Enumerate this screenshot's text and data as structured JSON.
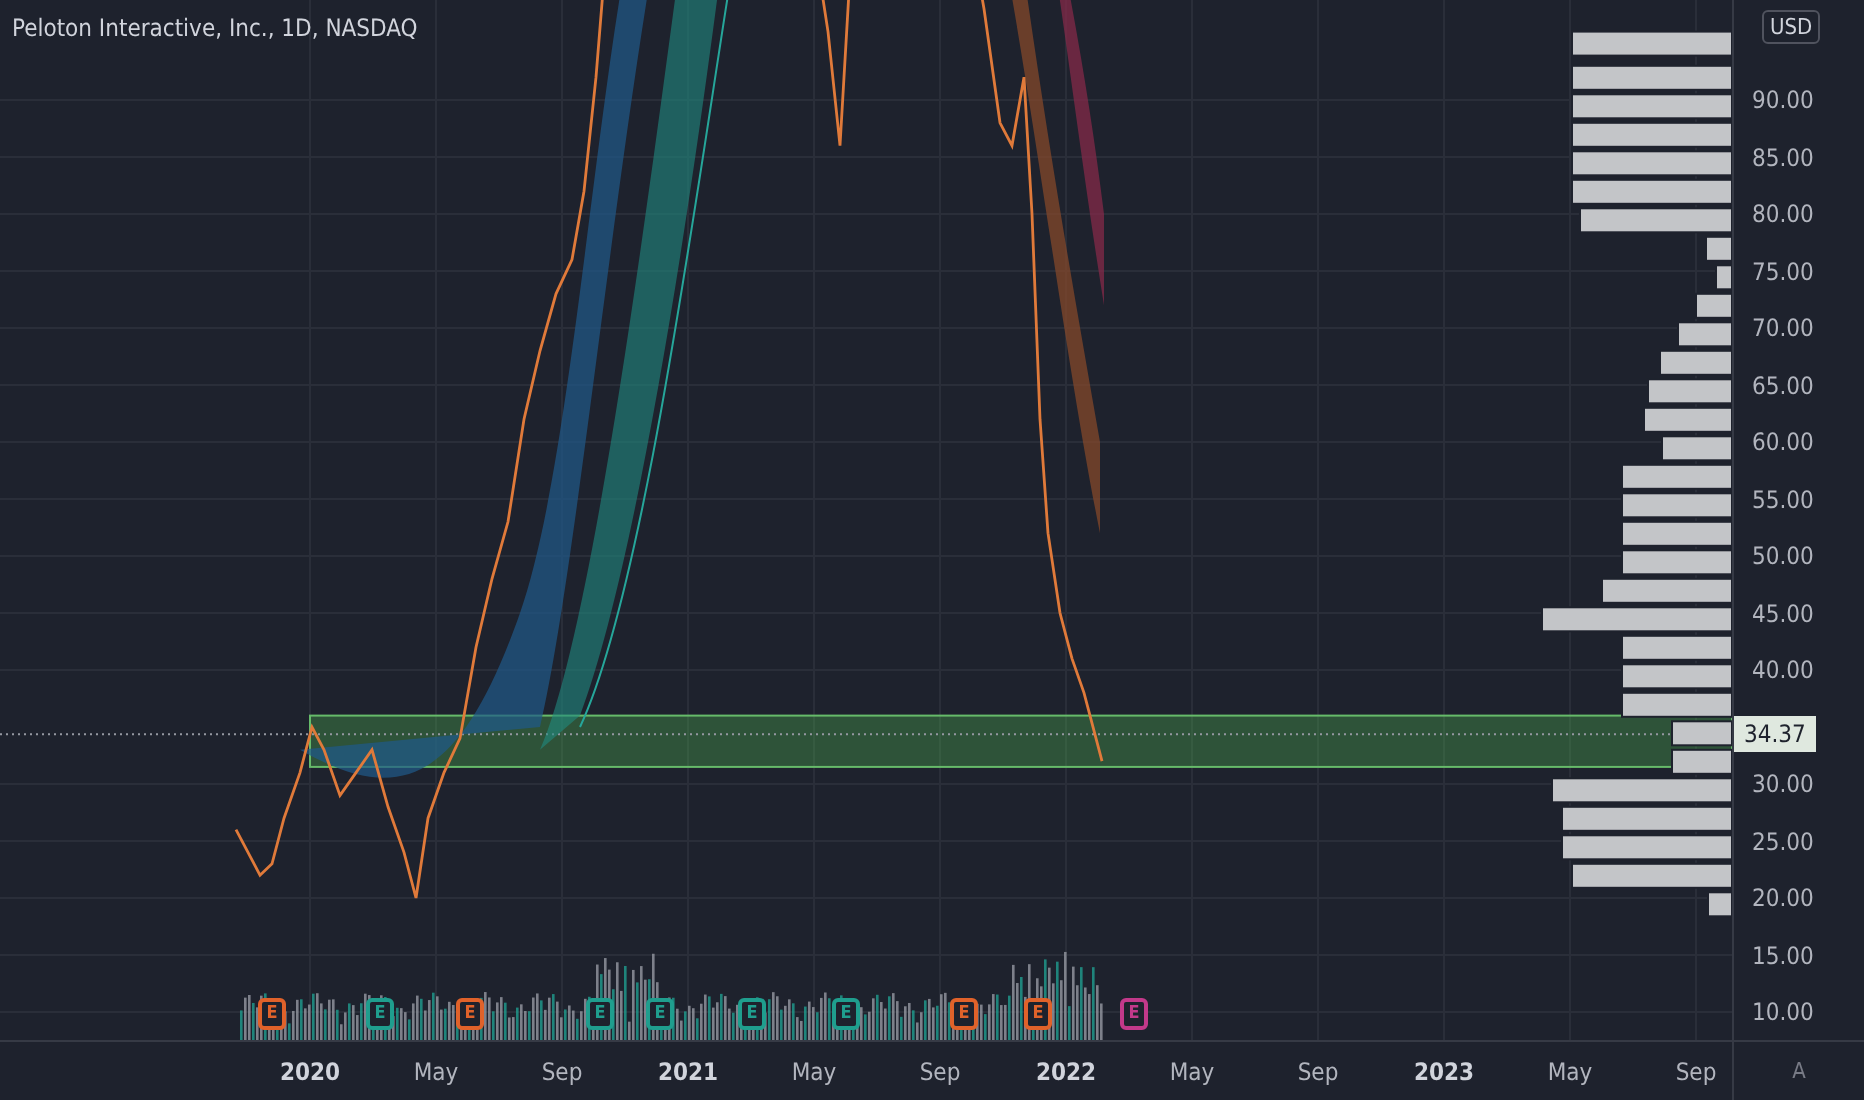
{
  "chart_title": "Peloton Interactive, Inc., 1D, NASDAQ",
  "currency": "USD",
  "price_axis": [
    "90.00",
    "85.00",
    "80.00",
    "75.00",
    "70.00",
    "65.00",
    "60.00",
    "55.00",
    "50.00",
    "45.00",
    "40.00",
    "30.00",
    "25.00",
    "20.00",
    "15.00",
    "10.00"
  ],
  "last_price": "34.37",
  "time_axis": [
    {
      "label": "2020",
      "kind": "year"
    },
    {
      "label": "May",
      "kind": "month"
    },
    {
      "label": "Sep",
      "kind": "month"
    },
    {
      "label": "2021",
      "kind": "year"
    },
    {
      "label": "May",
      "kind": "month"
    },
    {
      "label": "Sep",
      "kind": "month"
    },
    {
      "label": "2022",
      "kind": "year"
    },
    {
      "label": "May",
      "kind": "month"
    },
    {
      "label": "Sep",
      "kind": "month"
    },
    {
      "label": "2023",
      "kind": "year"
    },
    {
      "label": "May",
      "kind": "month"
    },
    {
      "label": "Sep",
      "kind": "month"
    }
  ],
  "earnings_markers": [
    {
      "label": "E",
      "color": "#e0622a"
    },
    {
      "label": "E",
      "color": "#1f9e8e"
    },
    {
      "label": "E",
      "color": "#e0622a"
    },
    {
      "label": "E",
      "color": "#1f9e8e"
    },
    {
      "label": "E",
      "color": "#1f9e8e"
    },
    {
      "label": "E",
      "color": "#1f9e8e"
    },
    {
      "label": "E",
      "color": "#1f9e8e"
    },
    {
      "label": "E",
      "color": "#e0622a"
    },
    {
      "label": "E",
      "color": "#e0622a"
    },
    {
      "label": "E",
      "color": "#c2398a"
    }
  ],
  "auto_scale": "A"
}
